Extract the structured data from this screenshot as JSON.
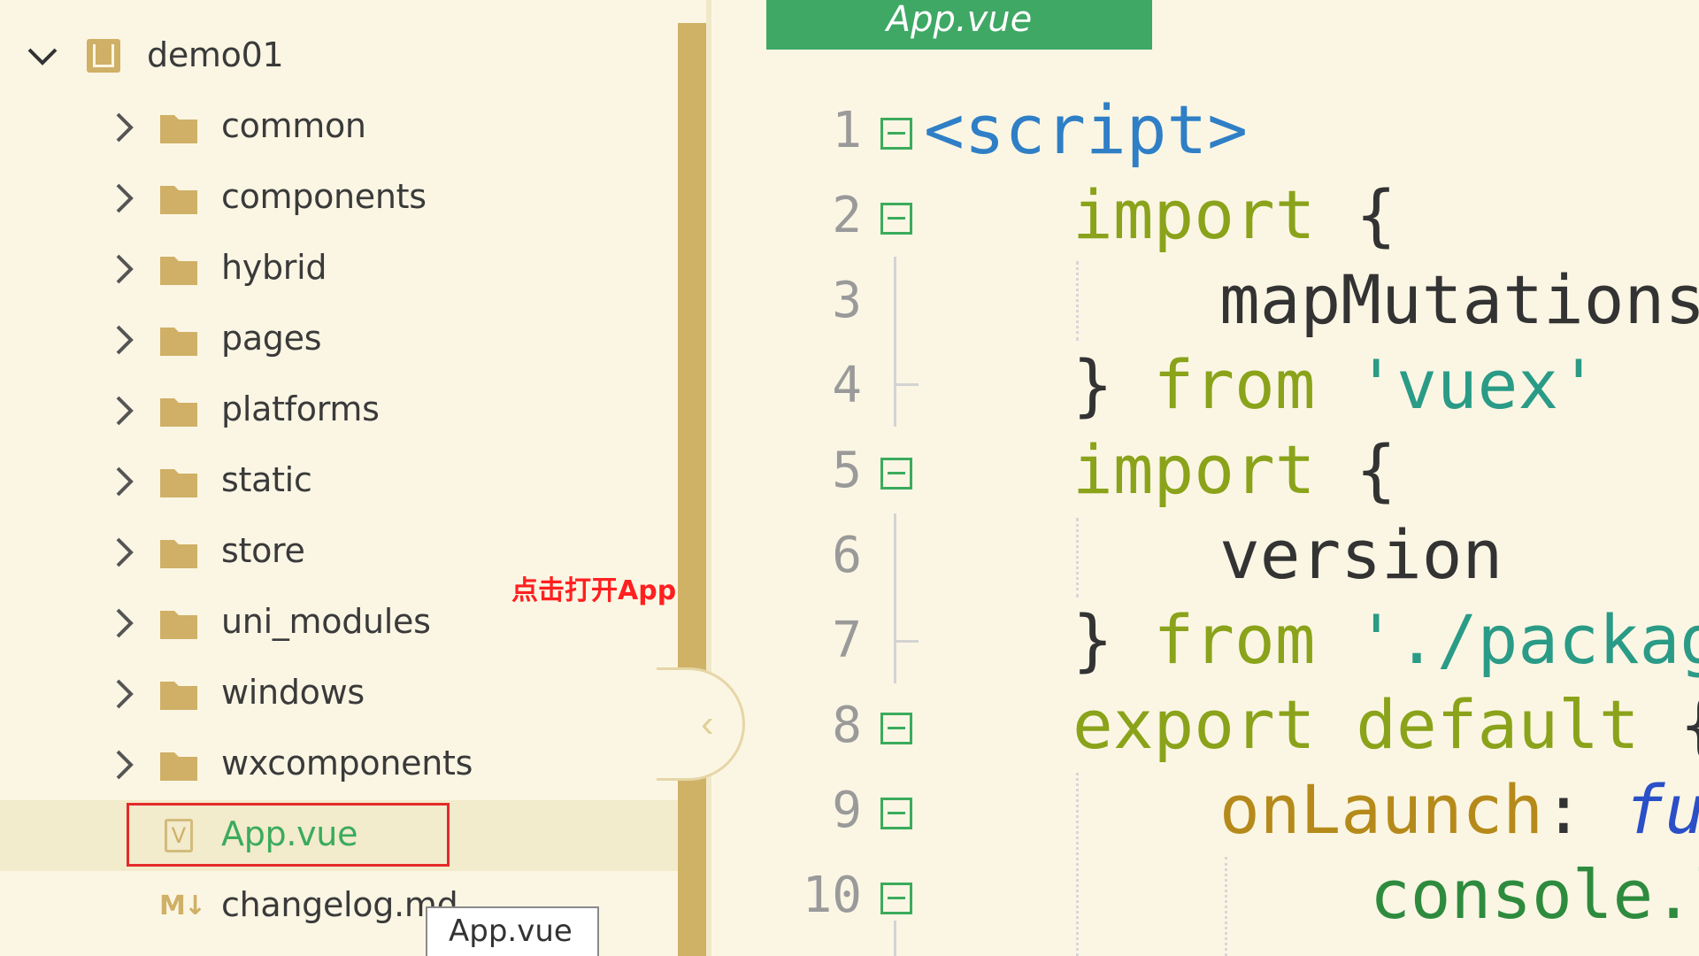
{
  "explorer": {
    "project": {
      "name": "demo01",
      "expanded": true
    },
    "folders": [
      {
        "label": "common"
      },
      {
        "label": "components"
      },
      {
        "label": "hybrid"
      },
      {
        "label": "pages"
      },
      {
        "label": "platforms"
      },
      {
        "label": "static"
      },
      {
        "label": "store"
      },
      {
        "label": "uni_modules"
      },
      {
        "label": "windows"
      },
      {
        "label": "wxcomponents"
      }
    ],
    "files": [
      {
        "label": "App.vue",
        "icon": "vue-file-icon",
        "selected": true
      },
      {
        "label": "changelog.md",
        "icon": "markdown-file-icon",
        "selected": false
      }
    ],
    "tooltip": "App.vue",
    "annotation": "点击打开App.vue"
  },
  "editor": {
    "tab_title": "App.vue",
    "line_numbers": [
      "1",
      "2",
      "3",
      "4",
      "5",
      "6",
      "7",
      "8",
      "9",
      "10"
    ],
    "code": {
      "l1": "<script>",
      "l2_kw": "import",
      "l2_brace": " {",
      "l3": "mapMutations",
      "l4_brace": "} ",
      "l4_kw": "from",
      "l4_str": "'vuex'",
      "l5_kw": "import",
      "l5_brace": " {",
      "l6": "version",
      "l7_brace": "} ",
      "l7_kw": "from",
      "l7_str": "'./package",
      "l8_kw": "export default",
      "l8_brace": " {",
      "l9_fn": "onLaunch",
      "l9_colon": ": ",
      "l9_kw": "fun",
      "l10": "console.l"
    }
  },
  "colors": {
    "background": "#fbf6e4",
    "accent_green": "#3fa865",
    "folder": "#cfb066",
    "annotation_red": "#ff2020"
  }
}
